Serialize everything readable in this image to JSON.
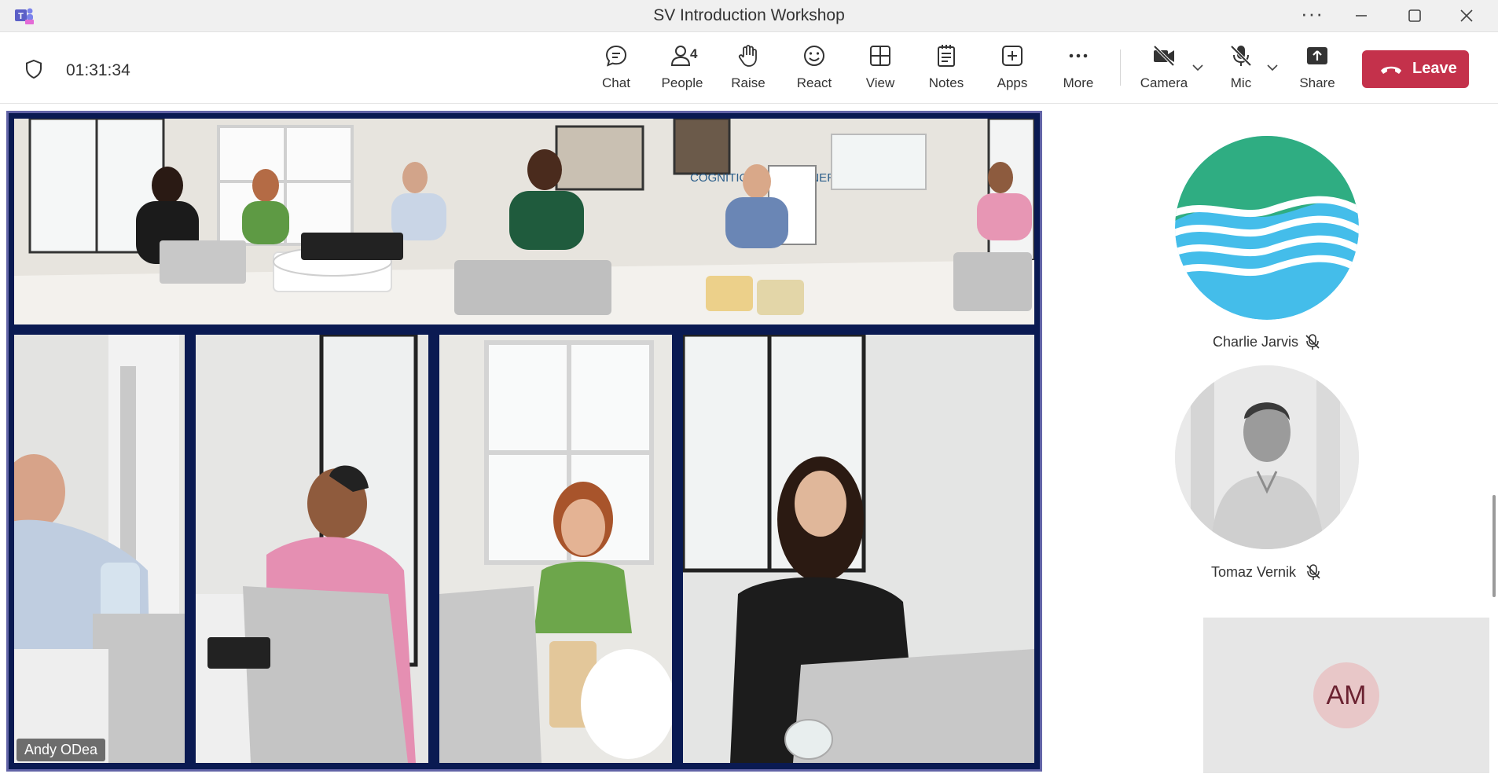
{
  "window": {
    "title": "SV Introduction Workshop",
    "more_glyph": "···"
  },
  "toolbar": {
    "timer": "01:31:34",
    "chat_label": "Chat",
    "people_label": "People",
    "people_count": "4",
    "raise_label": "Raise",
    "react_label": "React",
    "view_label": "View",
    "notes_label": "Notes",
    "apps_label": "Apps",
    "more_label": "More",
    "camera_label": "Camera",
    "mic_label": "Mic",
    "share_label": "Share",
    "leave_label": "Leave"
  },
  "stage": {
    "speaker_name": "Andy ODea",
    "panorama_sign": "COGNITION CLEAN ENERGY"
  },
  "participants": [
    {
      "name": "Charlie Jarvis",
      "muted": true,
      "avatar": "wave-logo"
    },
    {
      "name": "Tomaz Vernik",
      "muted": true,
      "avatar": "photo"
    },
    {
      "initials": "AM"
    }
  ],
  "colors": {
    "accent": "#6264a7",
    "leave": "#c4314b",
    "stage_bg": "#0a1a52",
    "am_badge": "#e8c7c8"
  },
  "icons": [
    "teams-logo",
    "shield-icon",
    "chat-icon",
    "people-icon",
    "raise-hand-icon",
    "react-icon",
    "view-icon",
    "notes-icon",
    "apps-icon",
    "more-icon",
    "camera-off-icon",
    "mic-off-icon",
    "share-icon",
    "phone-hangup-icon",
    "minimize-icon",
    "maximize-icon",
    "close-icon"
  ]
}
